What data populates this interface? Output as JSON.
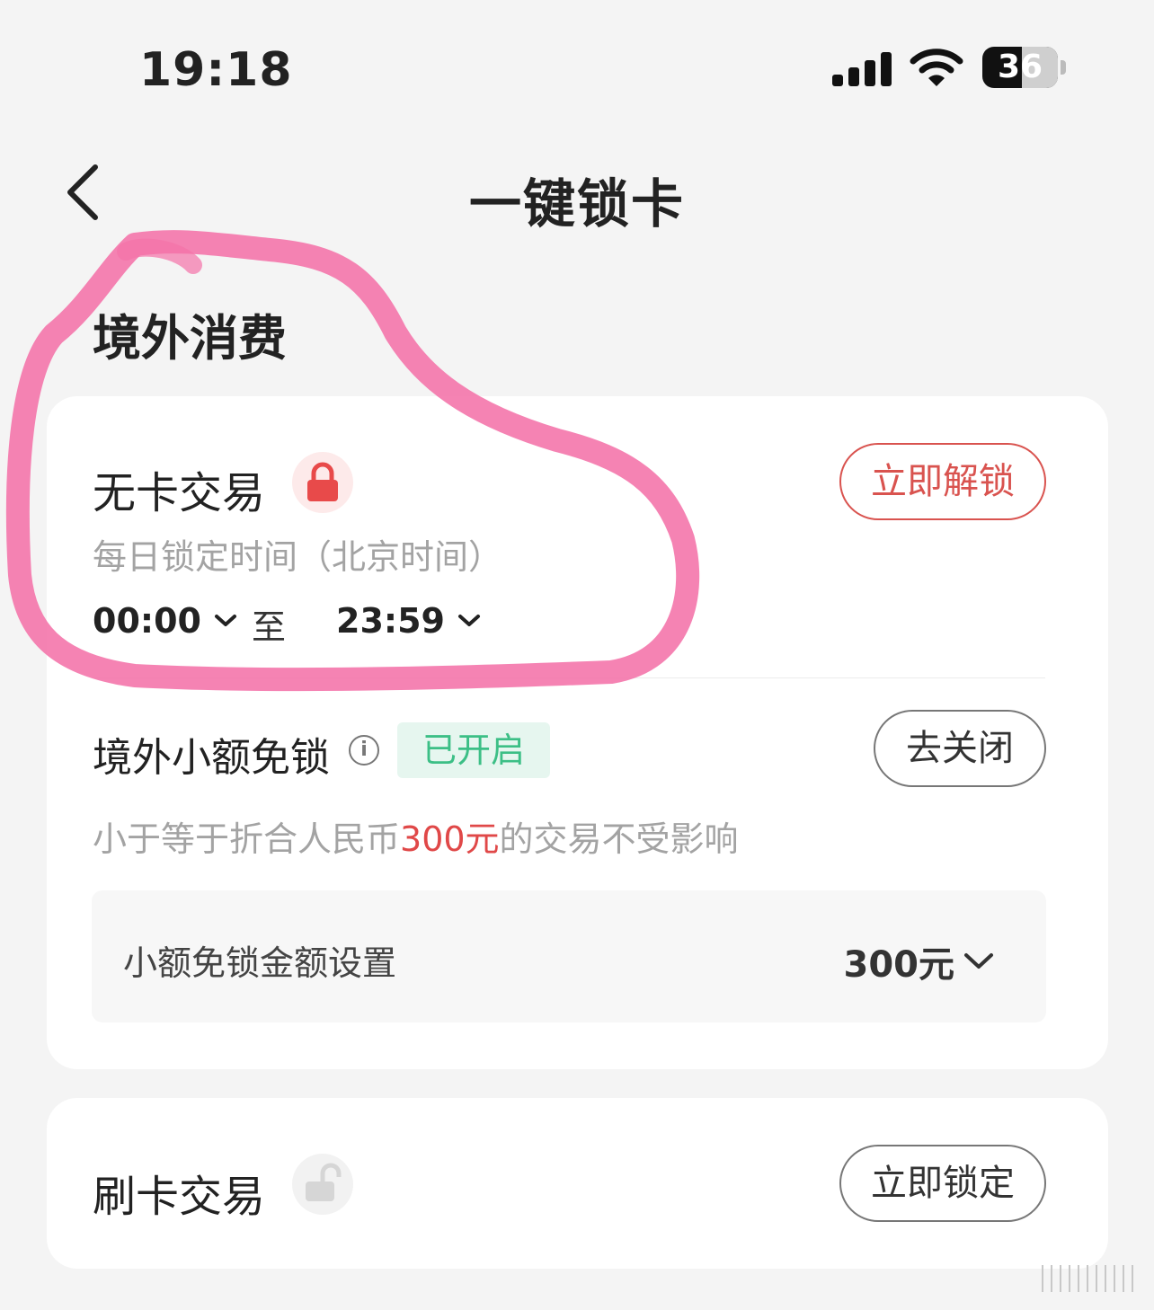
{
  "status_bar": {
    "time": "19:18",
    "battery": "36",
    "icons": [
      "signal-icon",
      "wifi-icon",
      "battery-icon"
    ]
  },
  "nav": {
    "back_icon": "chevron-left-icon",
    "title": "一键锁卡"
  },
  "section": {
    "title": "境外消费"
  },
  "cardless": {
    "title": "无卡交易",
    "lock_icon": "lock-closed-icon",
    "unlock_button": "立即解锁",
    "schedule_label": "每日锁定时间（北京时间）",
    "start_time": "00:00",
    "to_label": "至",
    "end_time": "23:59"
  },
  "small_amount": {
    "title": "境外小额免锁",
    "info_icon": "info-icon",
    "status_badge": "已开启",
    "close_button": "去关闭",
    "desc_prefix": "小于等于折合人民币",
    "desc_amount": "300元",
    "desc_suffix": "的交易不受影响",
    "setting_label": "小额免锁金额设置",
    "setting_value": "300元"
  },
  "swipe": {
    "title": "刷卡交易",
    "lock_icon": "lock-open-icon",
    "lock_button": "立即锁定"
  },
  "colors": {
    "accent_red": "#d9534f",
    "badge_green": "#3cbf86",
    "annotation_pink": "#f472a8"
  }
}
